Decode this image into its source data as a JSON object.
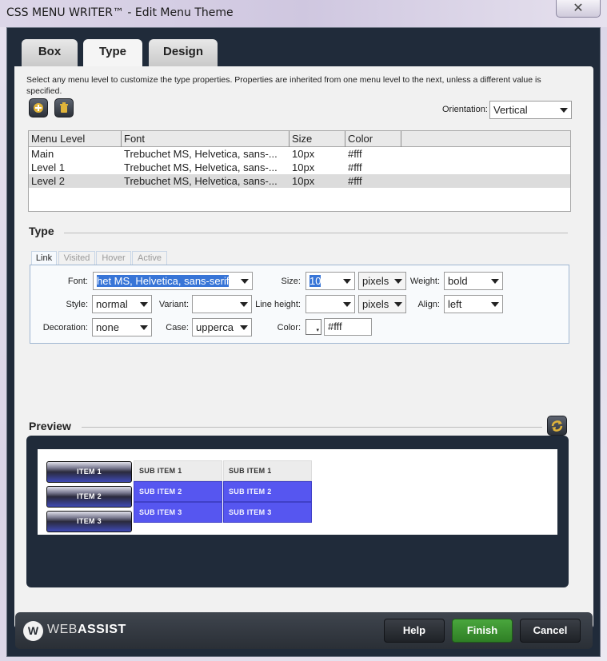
{
  "window": {
    "title": "CSS MENU WRITER™ - Edit Menu Theme",
    "close_glyph": "✕"
  },
  "tabs": [
    {
      "label": "Box"
    },
    {
      "label": "Type"
    },
    {
      "label": "Design"
    }
  ],
  "description": "Select any menu level to customize the type properties. Properties are inherited from one menu level to the next, unless a different value is specified.",
  "toolbar": {
    "add_icon": "plus-icon",
    "delete_icon": "trash-icon"
  },
  "orientation": {
    "label": "Orientation:",
    "value": "Vertical"
  },
  "levels_table": {
    "columns": [
      "Menu Level",
      "Font",
      "Size",
      "Color"
    ],
    "rows": [
      {
        "level": "Main",
        "font": "Trebuchet MS, Helvetica, sans-...",
        "size": "10px",
        "color": "#fff"
      },
      {
        "level": "Level 1",
        "font": "Trebuchet MS, Helvetica, sans-...",
        "size": "10px",
        "color": "#fff"
      },
      {
        "level": "Level 2",
        "font": "Trebuchet MS, Helvetica, sans-...",
        "size": "10px",
        "color": "#fff",
        "selected": true
      }
    ]
  },
  "type_section": {
    "title": "Type",
    "state_tabs": [
      "Link",
      "Visited",
      "Hover",
      "Active"
    ],
    "fields": {
      "font_label": "Font:",
      "font_value": "het MS, Helvetica, sans-serif",
      "size_label": "Size:",
      "size_value": "10",
      "size_unit": "pixels",
      "weight_label": "Weight:",
      "weight_value": "bold",
      "style_label": "Style:",
      "style_value": "normal",
      "variant_label": "Variant:",
      "variant_value": "",
      "line_height_label": "Line height:",
      "line_height_value": "",
      "line_height_unit": "pixels",
      "align_label": "Align:",
      "align_value": "left",
      "decoration_label": "Decoration:",
      "decoration_value": "none",
      "case_label": "Case:",
      "case_value": "upperca",
      "color_label": "Color:",
      "color_value": "#fff"
    }
  },
  "preview": {
    "title": "Preview",
    "menu_items": [
      "ITEM 1",
      "ITEM 2",
      "ITEM 3"
    ],
    "sub_col1": [
      "SUB ITEM 1",
      "SUB ITEM 2",
      "SUB ITEM 3"
    ],
    "sub_col2": [
      "SUB ITEM 1",
      "SUB ITEM 2",
      "SUB ITEM 3"
    ]
  },
  "footer": {
    "logo_mark": "W",
    "logo_text_light": "WEB",
    "logo_text_bold": "ASSIST",
    "help": "Help",
    "finish": "Finish",
    "cancel": "Cancel"
  },
  "colors": {
    "accent_blue": "#5656f0",
    "finish_green": "#3c8f31",
    "frame_dark": "#202b3a"
  }
}
